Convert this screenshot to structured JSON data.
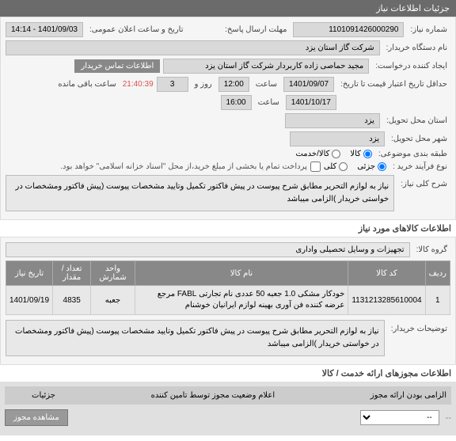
{
  "sections": {
    "info_header": "جزئیات اطلاعات نیاز",
    "goods_header": "اطلاعات کالاهای مورد نیاز",
    "permits_header": "اطلاعات مجوزهای ارائه خدمت / کالا"
  },
  "form": {
    "need_number_label": "شماره نیاز:",
    "need_number": "1101091426000290",
    "send_time_label": "مهلت ارسال پاسخ:",
    "announce_label": "تاریخ و ساعت اعلان عمومی:",
    "announce_value": "1401/09/03 - 14:14",
    "buyer_name_label": "نام دستگاه خریدار:",
    "buyer_name": "شرکت گاز استان یزد",
    "requester_label": "ایجاد کننده درخواست:",
    "requester": "مجید حماصی زاده کاربردار شرکت گاز استان یزد",
    "contact_btn": "اطلاعات تماس خریدار",
    "expire_label": "حداقل تاریخ اعتبار قیمت تا تاریخ:",
    "expire_date": "1401/09/07",
    "time1_label": "ساعت",
    "time1": "12:00",
    "day_label": "روز و",
    "day_value": "3",
    "timer": "21:40:39",
    "timer_label": "ساعت باقی مانده",
    "date2": "1401/10/17",
    "time2": "16:00",
    "delivery_province_label": "استان محل تحویل:",
    "delivery_city_label": "شهر محل تحویل:",
    "province": "یزد",
    "city": "یزد",
    "class_label": "طبقه بندی موضوعی:",
    "class_goods": "کالا",
    "class_service": "کالا/خدمت",
    "purchase_type_label": "نوع فرآیند خرید :",
    "pt_partial": "جزئی",
    "pt_full": "کلی",
    "payment_note": "پرداخت تمام یا بخشی از مبلغ خرید،از محل \"اسناد خزانه اسلامی\" خواهد بود.",
    "desc_label": "شرح کلی نیاز:",
    "desc_text": "نیاز به لوازم التحریر مطابق شرح پیوست در پیش فاکتور تکمیل وتایید مشخصات پیوست (پیش فاکتور ومشخصات در خواستی خریدار )الزامی میباشد",
    "group_label": "گروه کالا:",
    "group_value": "تجهیزات و وسایل تحصیلی واداری",
    "buyer_notes_label": "توضیحات خریدار:",
    "buyer_notes": "نیاز به لوازم التحریر مطابق شرح پیوست در پیش فاکتور تکمیل وتایید مشخصات پیوست (پیش فاکتور ومشخصات در خواستی خریدار )الزامی میباشد"
  },
  "table": {
    "headers": {
      "row": "ردیف",
      "code": "کد کالا",
      "name": "نام کالا",
      "unit": "واحد شمارش",
      "qty": "تعداد / مقدار",
      "date": "تاریخ نیاز"
    },
    "rows": [
      {
        "idx": "1",
        "code": "1131213285610004",
        "name": "خودکار مشکی 1.0 جعبه 50 عددی نام تجارتی FABL مرجع عرضه کننده فن آوری بهینه لوازم ایرانیان خوشنام",
        "unit": "جعبه",
        "qty": "4835",
        "date": "1401/09/19"
      }
    ]
  },
  "lower": {
    "mandatory_label": "الزامی بودن ارائه مجوز",
    "status_label": "اعلام وضعیت مجوز توسط تامین کننده",
    "details_label": "جزئیات",
    "select_placeholder": "--",
    "view_permit": "مشاهده مجوز"
  }
}
